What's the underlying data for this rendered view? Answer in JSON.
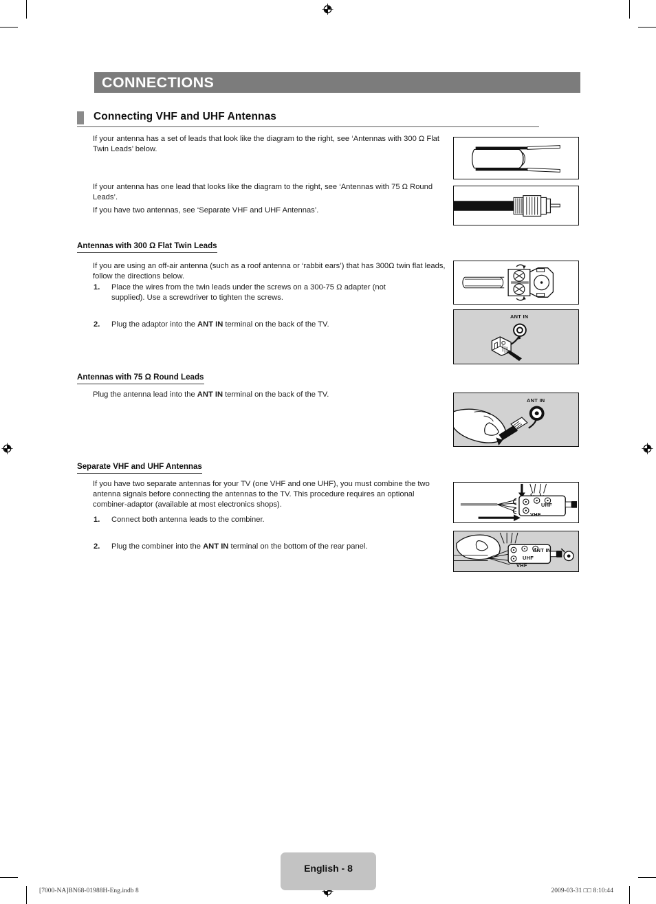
{
  "chapter": {
    "title": "CONNECTIONS"
  },
  "section": {
    "title": "Connecting VHF and UHF Antennas"
  },
  "intro": {
    "para1": "If your antenna has a set of leads that look like the diagram to the right, see ‘Antennas with 300 Ω Flat Twin Leads’ below.",
    "para2": "If your antenna has one lead that looks like the diagram to the right, see ‘Antennas with 75 Ω Round Leads’.",
    "para3": "If you have two antennas, see ‘Separate VHF and UHF Antennas’."
  },
  "flat_twin": {
    "heading": "Antennas with 300 Ω Flat Twin Leads",
    "body": "If you are using an off-air antenna (such as a roof antenna or ‘rabbit ears’) that has 300Ω twin flat leads, follow the directions below.",
    "steps": [
      {
        "num": "1.",
        "text_before": "Place the wires from the twin leads under the screws on a 300-75 Ω adapter (not supplied). Use a screwdriver to tighten the screws.",
        "bold": "",
        "text_after": ""
      },
      {
        "num": "2.",
        "text_before": "Plug the adaptor into the ",
        "bold": "ANT IN",
        "text_after": " terminal on the back of the TV."
      }
    ]
  },
  "round_leads": {
    "heading": "Antennas with 75 Ω Round Leads",
    "body_before": "Plug the antenna lead into the ",
    "body_bold": "ANT IN",
    "body_after": " terminal on the back of the TV."
  },
  "separate": {
    "heading": "Separate VHF and UHF Antennas",
    "body": "If you have two separate antennas for your TV (one VHF and one UHF), you must combine the two antenna signals before connecting the antennas to the TV. This procedure requires an optional combiner-adaptor (available at most electronics shops).",
    "steps": [
      {
        "num": "1.",
        "text_before": "Connect both antenna leads to the combiner.",
        "bold": "",
        "text_after": ""
      },
      {
        "num": "2.",
        "text_before": "Plug the combiner into the ",
        "bold": "ANT IN",
        "text_after": " terminal on the bottom of the rear panel."
      }
    ]
  },
  "figures": {
    "flat_twin_cable": {
      "name": "flat-twin-lead-cable",
      "shaded": false,
      "label": ""
    },
    "round_cable": {
      "name": "round-lead-coax-cable",
      "shaded": false,
      "label": ""
    },
    "adapter_screws": {
      "name": "300-75-ohm-adapter-screws",
      "shaded": false,
      "label": ""
    },
    "adapter_ant_in": {
      "name": "adapter-into-ant-in",
      "shaded": true,
      "label": "ANT IN"
    },
    "hand_ant_in": {
      "name": "hand-plugging-ant-in",
      "shaded": true,
      "label": "ANT IN"
    },
    "combiner": {
      "name": "combiner-uhf-vhf",
      "shaded": false,
      "label_uhf": "UHF",
      "label_vhf": "VHF"
    },
    "combiner_ant_in": {
      "name": "combiner-into-ant-in",
      "shaded": true,
      "label": "ANT IN",
      "label_uhf": "UHF",
      "label_vhf": "VHF"
    }
  },
  "footer": {
    "page_label": "English - 8",
    "file_ref": "[7000-NA]BN68-01988H-Eng.indb   8",
    "timestamp": "2009-03-31   □□ 8:10:44"
  },
  "colors": {
    "chapter_bar": "#7c7c7c",
    "section_tab": "#8a8a8a",
    "figure_shade": "#d2d2d2",
    "page_badge": "#c3c3c3"
  }
}
